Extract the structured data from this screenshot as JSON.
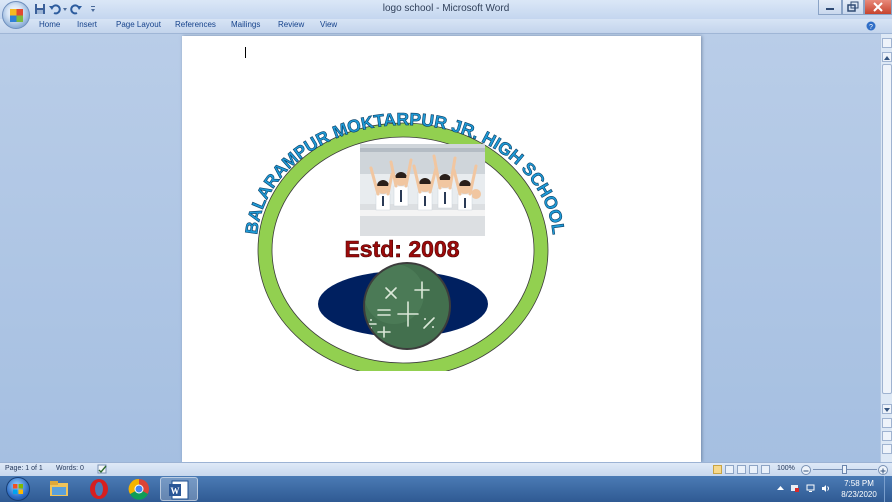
{
  "window": {
    "title": "logo school - Microsoft Word"
  },
  "ribbon": {
    "tabs": [
      "Home",
      "Insert",
      "Page Layout",
      "References",
      "Mailings",
      "Review",
      "View"
    ]
  },
  "document": {
    "logo": {
      "arc_text": "BALARAMPUR MOKTARPUR JR. HIGH SCHOOL",
      "established_text": "Estd: 2008",
      "colors": {
        "ring": "#92d050",
        "arc_text": "#1e9ad6",
        "estd_text": "#9c0a0a",
        "oval": "#002060"
      }
    }
  },
  "statusbar": {
    "page": "Page: 1 of 1",
    "words": "Words: 0",
    "zoom": "100%"
  },
  "taskbar": {
    "time": "7:58 PM",
    "date": "8/23/2020"
  }
}
